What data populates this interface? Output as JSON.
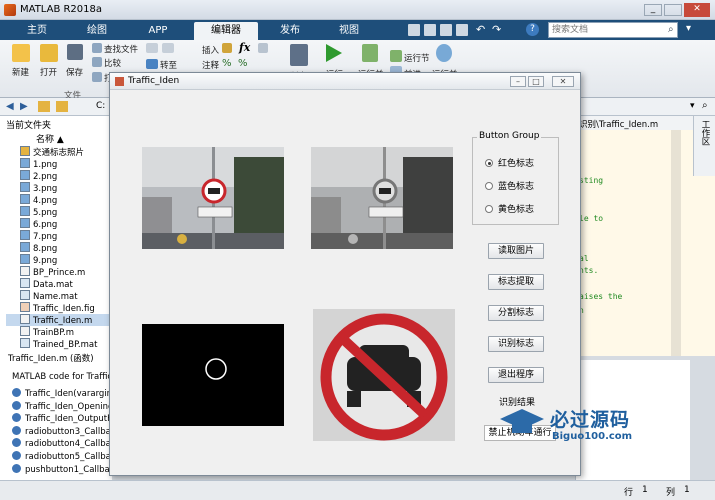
{
  "window": {
    "title": "MATLAB R2018a"
  },
  "tabs": [
    {
      "label": "主页",
      "active": false
    },
    {
      "label": "绘图",
      "active": false
    },
    {
      "label": "APP",
      "active": false
    },
    {
      "label": "编辑器",
      "active": true
    },
    {
      "label": "发布",
      "active": false
    },
    {
      "label": "视图",
      "active": false
    }
  ],
  "search": {
    "placeholder": "搜索文档"
  },
  "ribbon": {
    "new": "新建",
    "open": "打开",
    "save": "保存",
    "find_files": "查找文件",
    "compare": "比较",
    "print_label": "打",
    "insert": "插入",
    "comment": "注释",
    "indent": "缩",
    "goto": "转至",
    "breakpoint": "断点",
    "run": "运行",
    "run_advance": "运行并",
    "run_section": "运行节",
    "advance": "前进",
    "run_time": "运行并",
    "section_file": "文件"
  },
  "path": {
    "text": "C:"
  },
  "right_path": {
    "text": "识别\\Traffic_Iden.m"
  },
  "workspace_tab": {
    "label": "工作区"
  },
  "current_folder": {
    "title": "当前文件夹",
    "col_name": "名称 ▲"
  },
  "files": [
    {
      "name": "交通标志照片",
      "kind": "folder"
    },
    {
      "name": "1.png",
      "kind": "img"
    },
    {
      "name": "2.png",
      "kind": "img"
    },
    {
      "name": "3.png",
      "kind": "img"
    },
    {
      "name": "4.png",
      "kind": "img"
    },
    {
      "name": "5.png",
      "kind": "img"
    },
    {
      "name": "6.png",
      "kind": "img"
    },
    {
      "name": "7.png",
      "kind": "img"
    },
    {
      "name": "8.png",
      "kind": "img"
    },
    {
      "name": "9.png",
      "kind": "img"
    },
    {
      "name": "BP_Prince.m",
      "kind": "m"
    },
    {
      "name": "Data.mat",
      "kind": "mat"
    },
    {
      "name": "Name.mat",
      "kind": "mat"
    },
    {
      "name": "Traffic_Iden.fig",
      "kind": "fig"
    },
    {
      "name": "Traffic_Iden.m",
      "kind": "m",
      "selected": true
    },
    {
      "name": "TrainBP.m",
      "kind": "m"
    },
    {
      "name": "Trained_BP.mat",
      "kind": "mat"
    }
  ],
  "details": {
    "label": "Traffic_Iden.m   (函数)"
  },
  "func_panel": {
    "heading": "MATLAB code for Traffic",
    "items": [
      "Traffic_Iden(varargin)",
      "Traffic_Iden_Opening",
      "Traffic_Iden_OutputFc",
      "radiobutton3_Callback",
      "radiobutton4_Callback",
      "radiobutton5_Callback",
      "pushbutton1_Callback"
    ]
  },
  "editor_lines": [
    "sting",
    "le to",
    "al",
    "nts.",
    "aises the",
    "n"
  ],
  "dialog": {
    "title": "Traffic_Iden",
    "group_title": "Button Group",
    "radios": [
      {
        "label": "红色标志",
        "checked": true
      },
      {
        "label": "蓝色标志",
        "checked": false
      },
      {
        "label": "黄色标志",
        "checked": false
      }
    ],
    "buttons": [
      "读取图片",
      "标志提取",
      "分割标志",
      "识别标志",
      "退出程序"
    ],
    "result_label": "识别结果",
    "result_value": "禁止机动车通行"
  },
  "watermark": {
    "line1": "必过源码",
    "line2": "Biguo100.com"
  },
  "status": {
    "row_label": "行",
    "row": "1",
    "col_label": "列",
    "col": "1"
  },
  "colors": {
    "accent": "#1e4e7a",
    "sign_red": "#c8262c"
  }
}
